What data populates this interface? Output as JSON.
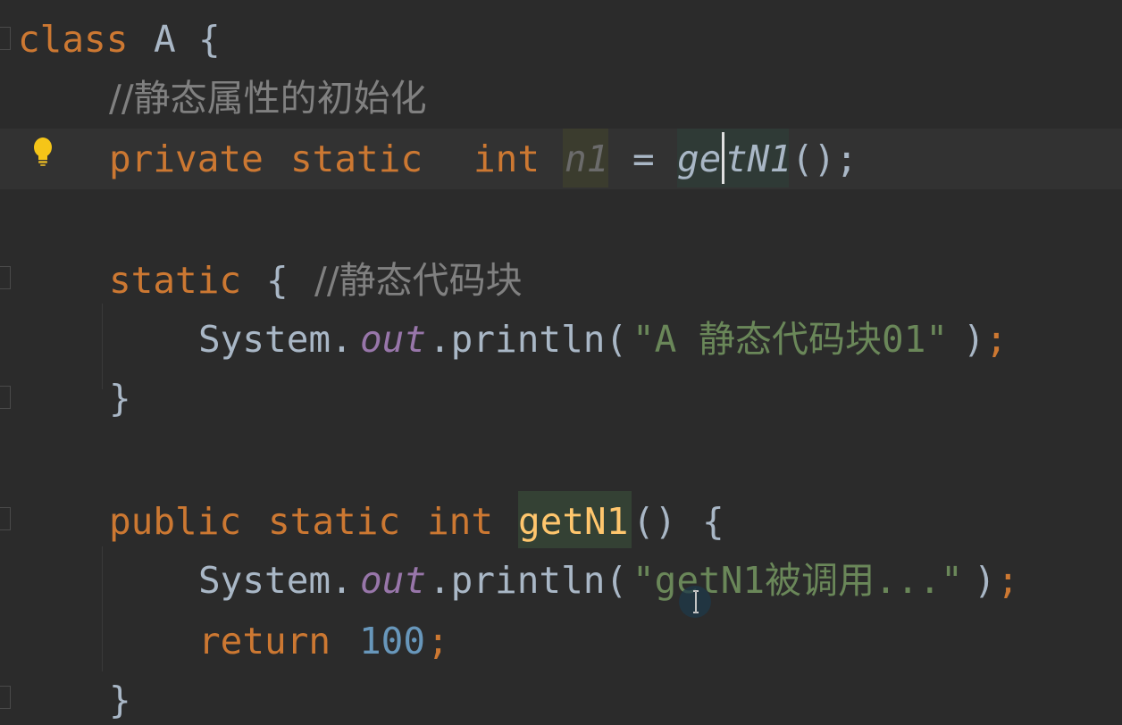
{
  "code": {
    "class_kw": "class",
    "class_name": "A",
    "open_brace": "{",
    "comment_static_init": "//静态属性的初始化",
    "field": {
      "mod1": "private",
      "mod2": "static",
      "type": "int",
      "name": "n1",
      "assign": "=",
      "call_ge": "ge",
      "call_rest": "tN1",
      "call_tail": "();"
    },
    "static_block": {
      "kw": "static",
      "brace": "{",
      "comment": "//静态代码块",
      "sys": "System.",
      "out": "out",
      "println": ".println(",
      "literal": "\"A 静态代码块01\"",
      "close_paren": ")",
      "semicolon": ";",
      "close": "}"
    },
    "method": {
      "mod1": "public",
      "mod2": "static",
      "type": "int",
      "name": "getN1",
      "params": "()",
      "brace": "{",
      "sys": "System.",
      "out": "out",
      "println": ".println(",
      "literal": "\"getN1被调用...\"",
      "close_paren": ")",
      "semicolon": ";",
      "return_kw": "return",
      "return_val": "100",
      "return_semi": ";",
      "close": "}"
    }
  },
  "colors": {
    "background": "#2b2b2b",
    "keyword": "#cc7832",
    "comment": "#808080",
    "string": "#6a8759",
    "number": "#6897bb",
    "field": "#9876aa",
    "method_decl": "#ffc66d",
    "default_text": "#a9b7c6"
  },
  "icons": {
    "intention": "lightbulb-icon",
    "pointer": "text-cursor-icon"
  }
}
